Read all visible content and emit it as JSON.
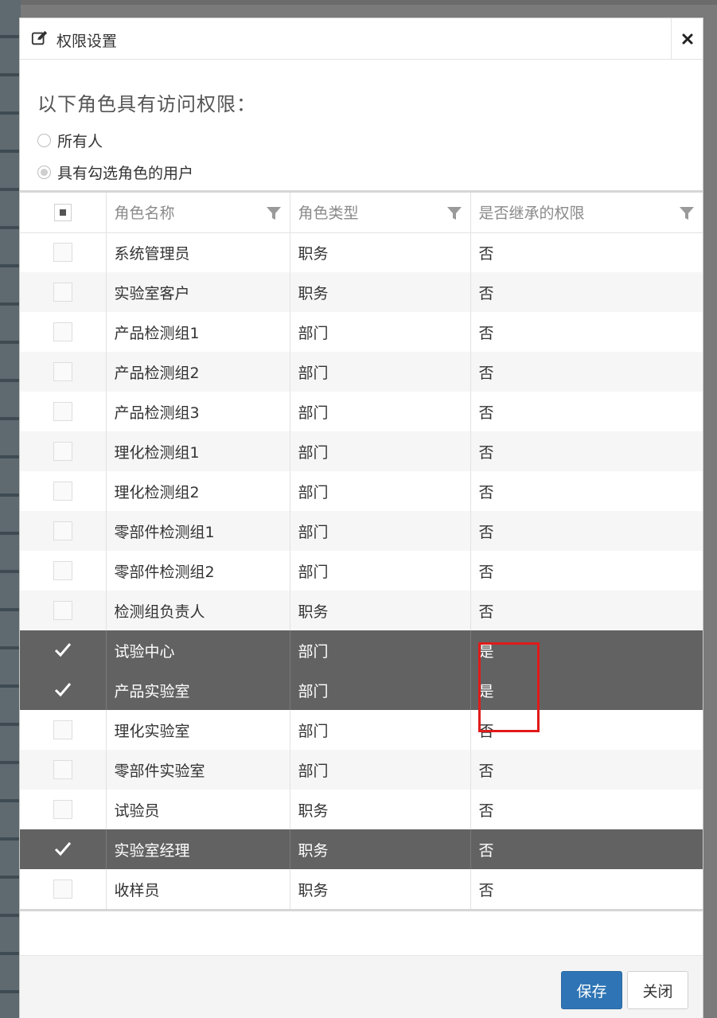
{
  "dialog": {
    "title": "权限设置",
    "icon": "edit-icon",
    "question": "以下角色具有访问权限：",
    "radios": [
      {
        "label": "所有人",
        "checked": false
      },
      {
        "label": "具有勾选角色的用户",
        "checked": true
      }
    ],
    "columns": [
      "角色名称",
      "角色类型",
      "是否继承的权限"
    ],
    "rows": [
      {
        "name": "系统管理员",
        "type": "职务",
        "inherited": "否",
        "checked": false
      },
      {
        "name": "实验室客户",
        "type": "职务",
        "inherited": "否",
        "checked": false
      },
      {
        "name": "产品检测组1",
        "type": "部门",
        "inherited": "否",
        "checked": false
      },
      {
        "name": "产品检测组2",
        "type": "部门",
        "inherited": "否",
        "checked": false
      },
      {
        "name": "产品检测组3",
        "type": "部门",
        "inherited": "否",
        "checked": false
      },
      {
        "name": "理化检测组1",
        "type": "部门",
        "inherited": "否",
        "checked": false
      },
      {
        "name": "理化检测组2",
        "type": "部门",
        "inherited": "否",
        "checked": false
      },
      {
        "name": "零部件检测组1",
        "type": "部门",
        "inherited": "否",
        "checked": false
      },
      {
        "name": "零部件检测组2",
        "type": "部门",
        "inherited": "否",
        "checked": false
      },
      {
        "name": "检测组负责人",
        "type": "职务",
        "inherited": "否",
        "checked": false
      },
      {
        "name": "试验中心",
        "type": "部门",
        "inherited": "是",
        "checked": true
      },
      {
        "name": "产品实验室",
        "type": "部门",
        "inherited": "是",
        "checked": true
      },
      {
        "name": "理化实验室",
        "type": "部门",
        "inherited": "否",
        "checked": false
      },
      {
        "name": "零部件实验室",
        "type": "部门",
        "inherited": "否",
        "checked": false
      },
      {
        "name": "试验员",
        "type": "职务",
        "inherited": "否",
        "checked": false
      },
      {
        "name": "实验室经理",
        "type": "职务",
        "inherited": "否",
        "checked": true
      },
      {
        "name": "收样员",
        "type": "职务",
        "inherited": "否",
        "checked": false
      }
    ],
    "save_label": "保存",
    "close_label": "关闭"
  },
  "colors": {
    "selected_row": "#626262",
    "primary_button": "#2f75b5",
    "annotation_box": "#e01b1b"
  }
}
